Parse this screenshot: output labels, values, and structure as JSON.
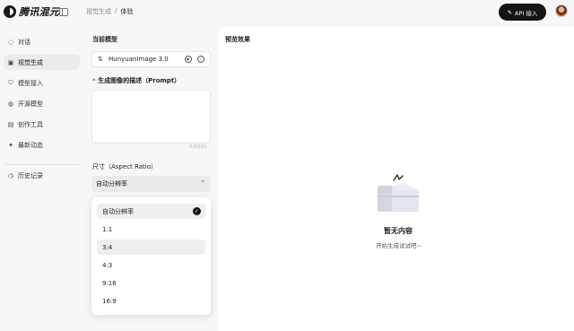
{
  "app": {
    "logo_text": "腾讯混元"
  },
  "breadcrumb": {
    "parent": "视觉生成",
    "separator": "/",
    "current": "体验"
  },
  "header": {
    "api_button_label": "API 接入",
    "api_button_icon": "pencil-icon"
  },
  "sidebar": {
    "items": [
      {
        "label": "对话",
        "icon": "chat-icon"
      },
      {
        "label": "视觉生成",
        "icon": "image-icon",
        "active": true
      },
      {
        "label": "模型接入",
        "icon": "api-icon"
      },
      {
        "label": "开源模型",
        "icon": "github-icon"
      },
      {
        "label": "创作工具",
        "icon": "toolbox-icon"
      },
      {
        "label": "最新动态",
        "icon": "sparkle-icon"
      }
    ],
    "history_label": "历史记录"
  },
  "settings": {
    "current_model_label": "当前模型",
    "model_name": "HunyuanImage 3.0",
    "prompt_label": "生成图像的描述（Prompt）",
    "prompt_required_mark": "*",
    "prompt_value": "",
    "prompt_counter": "0/5000",
    "size_label": "尺寸（Aspect Ratio）",
    "size_selected": "自动分辨率",
    "size_options": [
      "自动分辨率",
      "1:1",
      "3:4",
      "4:3",
      "9:16",
      "16:9"
    ]
  },
  "preview": {
    "title": "预览效果",
    "empty_title": "暂无内容",
    "empty_subtitle": "开始生成试试吧~"
  }
}
